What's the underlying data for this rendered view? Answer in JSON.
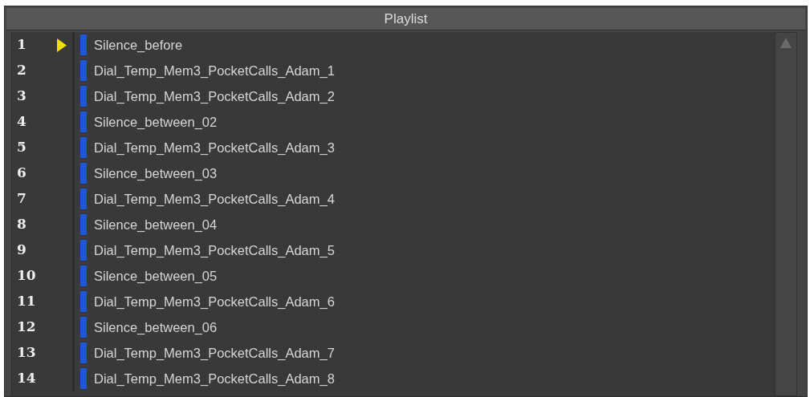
{
  "panel": {
    "title": "Playlist"
  },
  "items": [
    {
      "number": "1",
      "name": "Silence_before",
      "playing": true
    },
    {
      "number": "2",
      "name": "Dial_Temp_Mem3_PocketCalls_Adam_1",
      "playing": false
    },
    {
      "number": "3",
      "name": "Dial_Temp_Mem3_PocketCalls_Adam_2",
      "playing": false
    },
    {
      "number": "4",
      "name": "Silence_between_02",
      "playing": false
    },
    {
      "number": "5",
      "name": "Dial_Temp_Mem3_PocketCalls_Adam_3",
      "playing": false
    },
    {
      "number": "6",
      "name": "Silence_between_03",
      "playing": false
    },
    {
      "number": "7",
      "name": "Dial_Temp_Mem3_PocketCalls_Adam_4",
      "playing": false
    },
    {
      "number": "8",
      "name": "Silence_between_04",
      "playing": false
    },
    {
      "number": "9",
      "name": "Dial_Temp_Mem3_PocketCalls_Adam_5",
      "playing": false
    },
    {
      "number": "10",
      "name": "Silence_between_05",
      "playing": false
    },
    {
      "number": "11",
      "name": "Dial_Temp_Mem3_PocketCalls_Adam_6",
      "playing": false
    },
    {
      "number": "12",
      "name": "Silence_between_06",
      "playing": false
    },
    {
      "number": "13",
      "name": "Dial_Temp_Mem3_PocketCalls_Adam_7",
      "playing": false
    },
    {
      "number": "14",
      "name": "Dial_Temp_Mem3_PocketCalls_Adam_8",
      "playing": false
    }
  ]
}
